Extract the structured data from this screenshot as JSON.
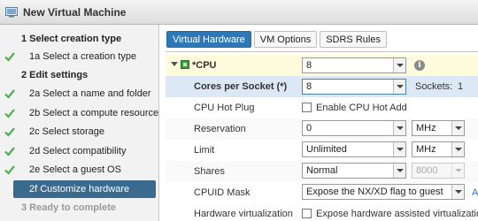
{
  "window": {
    "title": "New Virtual Machine"
  },
  "sidebar": {
    "steps": [
      {
        "label": "1  Select creation type"
      },
      {
        "label": "1a  Select a creation type"
      },
      {
        "label": "2  Edit settings"
      },
      {
        "label": "2a  Select a name and folder"
      },
      {
        "label": "2b  Select a compute resource"
      },
      {
        "label": "2c  Select storage"
      },
      {
        "label": "2d  Select compatibility"
      },
      {
        "label": "2e  Select a guest OS"
      },
      {
        "label": "2f  Customize hardware"
      },
      {
        "label": "3  Ready to complete"
      }
    ]
  },
  "tabs": [
    {
      "label": "Virtual Hardware"
    },
    {
      "label": "VM Options"
    },
    {
      "label": "SDRS Rules"
    }
  ],
  "hardware": {
    "cpu": {
      "label": "*CPU",
      "value": "8",
      "info_icon": "i"
    },
    "cores": {
      "label": "Cores per Socket (*)",
      "value": "8",
      "sockets_label": "Sockets:",
      "sockets_value": "1"
    },
    "hotplug": {
      "label": "CPU Hot Plug",
      "checkbox_label": "Enable CPU Hot Add"
    },
    "reservation": {
      "label": "Reservation",
      "value": "0",
      "unit": "MHz"
    },
    "limit": {
      "label": "Limit",
      "value": "Unlimited",
      "unit": "MHz"
    },
    "shares": {
      "label": "Shares",
      "value": "Normal",
      "amount": "8000"
    },
    "cpuid": {
      "label": "CPUID Mask",
      "value": "Expose the NX/XD flag to guest",
      "adv": "A"
    },
    "hwvirt": {
      "label": "Hardware virtualization",
      "checkbox_label": "Expose hardware assisted virtualization to"
    }
  },
  "colors": {
    "accent": "#2f78b6",
    "active_step": "#3b6a8f",
    "check": "#4caf50",
    "cpu_row": "#fffbdc",
    "selected_row": "#dce8f5"
  }
}
